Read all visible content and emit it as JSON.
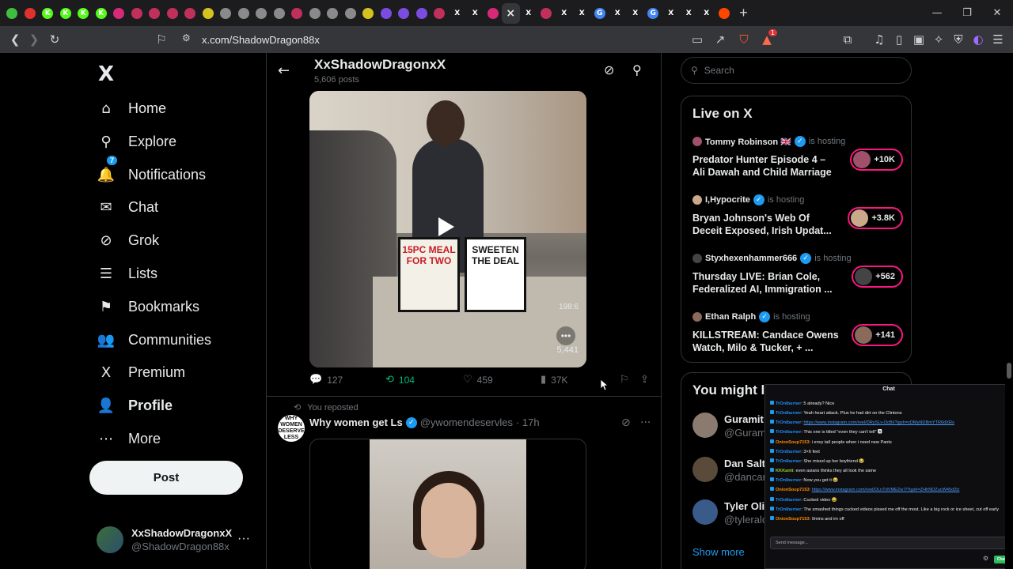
{
  "browser": {
    "url": "x.com/ShadowDragon88x",
    "tabs": [
      {
        "icon": "green-circle-icon",
        "color": "#3fbf3f",
        "glyph": ""
      },
      {
        "icon": "red-circle-icon",
        "color": "#e03030",
        "glyph": ""
      },
      {
        "icon": "kick-icon",
        "color": "#53fc18",
        "glyph": "K"
      },
      {
        "icon": "kick-icon",
        "color": "#53fc18",
        "glyph": "K"
      },
      {
        "icon": "kick-icon",
        "color": "#53fc18",
        "glyph": "K"
      },
      {
        "icon": "kick-icon",
        "color": "#53fc18",
        "glyph": "K"
      },
      {
        "icon": "instagram-icon",
        "color": "#d62976",
        "glyph": ""
      },
      {
        "icon": "red-icon",
        "color": "#c0305a",
        "glyph": ""
      },
      {
        "icon": "red-icon",
        "color": "#c0305a",
        "glyph": ""
      },
      {
        "icon": "red-icon",
        "color": "#c0305a",
        "glyph": ""
      },
      {
        "icon": "red-icon",
        "color": "#c0305a",
        "glyph": ""
      },
      {
        "icon": "yellow-icon",
        "color": "#d4c21f",
        "glyph": ""
      },
      {
        "icon": "grey-icon",
        "color": "#8a8a8a",
        "glyph": ""
      },
      {
        "icon": "grey-icon",
        "color": "#8a8a8a",
        "glyph": ""
      },
      {
        "icon": "grey-icon",
        "color": "#8a8a8a",
        "glyph": ""
      },
      {
        "icon": "grey-icon",
        "color": "#8a8a8a",
        "glyph": ""
      },
      {
        "icon": "red-icon",
        "color": "#c0305a",
        "glyph": ""
      },
      {
        "icon": "grey-icon",
        "color": "#8a8a8a",
        "glyph": ""
      },
      {
        "icon": "grey-icon",
        "color": "#8a8a8a",
        "glyph": ""
      },
      {
        "icon": "grey-icon",
        "color": "#8a8a8a",
        "glyph": ""
      },
      {
        "icon": "yellow-icon",
        "color": "#d4c21f",
        "glyph": ""
      },
      {
        "icon": "purple-icon",
        "color": "#7a4de0",
        "glyph": ""
      },
      {
        "icon": "purple-icon",
        "color": "#7a4de0",
        "glyph": ""
      },
      {
        "icon": "purple-icon",
        "color": "#7a4de0",
        "glyph": ""
      },
      {
        "icon": "red-icon",
        "color": "#c0305a",
        "glyph": ""
      },
      {
        "icon": "x-icon",
        "color": "#000000",
        "glyph": "X"
      },
      {
        "icon": "x-icon",
        "color": "#000000",
        "glyph": "X"
      },
      {
        "icon": "instagram-icon",
        "color": "#d62976",
        "glyph": ""
      },
      {
        "icon": "close-icon",
        "color": "#35363a",
        "glyph": "×"
      },
      {
        "icon": "x-icon",
        "color": "#000000",
        "glyph": "X"
      },
      {
        "icon": "red-icon",
        "color": "#c0305a",
        "glyph": ""
      },
      {
        "icon": "x-icon",
        "color": "#000000",
        "glyph": "X"
      },
      {
        "icon": "x-icon",
        "color": "#000000",
        "glyph": "X"
      },
      {
        "icon": "google-icon",
        "color": "#4285f4",
        "glyph": "G"
      },
      {
        "icon": "x-icon",
        "color": "#000000",
        "glyph": "X"
      },
      {
        "icon": "x-icon",
        "color": "#000000",
        "glyph": "X"
      },
      {
        "icon": "google-icon",
        "color": "#4285f4",
        "glyph": "G"
      },
      {
        "icon": "x-icon",
        "color": "#000000",
        "glyph": "X"
      },
      {
        "icon": "x-icon",
        "color": "#000000",
        "glyph": "X"
      },
      {
        "icon": "x-icon",
        "color": "#000000",
        "glyph": "X"
      },
      {
        "icon": "reddit-icon",
        "color": "#ff4500",
        "glyph": ""
      }
    ],
    "brave_badge": "1"
  },
  "nav": {
    "logo": "X",
    "items": [
      {
        "label": "Home",
        "icon": "home-icon",
        "glyph": "⌂"
      },
      {
        "label": "Explore",
        "icon": "search-icon",
        "glyph": "⚲"
      },
      {
        "label": "Notifications",
        "icon": "bell-icon",
        "glyph": "🔔",
        "badge": "7"
      },
      {
        "label": "Chat",
        "icon": "mail-icon",
        "glyph": "✉"
      },
      {
        "label": "Grok",
        "icon": "grok-icon",
        "glyph": "⊘"
      },
      {
        "label": "Lists",
        "icon": "lists-icon",
        "glyph": "☰"
      },
      {
        "label": "Bookmarks",
        "icon": "bookmark-icon",
        "glyph": "⚑"
      },
      {
        "label": "Communities",
        "icon": "communities-icon",
        "glyph": "👥"
      },
      {
        "label": "Premium",
        "icon": "x-premium-icon",
        "glyph": "X"
      },
      {
        "label": "Profile",
        "icon": "profile-icon",
        "glyph": "👤"
      },
      {
        "label": "More",
        "icon": "more-icon",
        "glyph": "⋯"
      }
    ],
    "post_button": "Post",
    "account": {
      "name": "XxShadowDragonxX",
      "handle": "@ShadowDragon88x",
      "more": "···"
    }
  },
  "profile_header": {
    "title": "XxShadowDragonxX",
    "posts": "5,606 posts"
  },
  "tweet1": {
    "video": {
      "sign1": "15PC MEAL FOR TWO",
      "sign2": "SWEETEN THE DEAL",
      "time": "198:6",
      "views": "5,441"
    },
    "replies": "127",
    "reposts": "104",
    "likes": "459",
    "views": "37K"
  },
  "tweet2": {
    "repost_note": "You reposted",
    "avatar_text": "WHY WOMEN DESERVE LESS",
    "name": "Why women get Ls",
    "handle": "@ywomendeservles",
    "time": "· 17h"
  },
  "sidebar": {
    "search_placeholder": "Search",
    "live_title": "Live on X",
    "live": [
      {
        "host": "Tommy Robinson 🇬🇧",
        "status": "is hosting",
        "title": "Predator Hunter Episode 4 – Ali Dawah and Child Marriage",
        "count": "+10K",
        "color": "#a0506a"
      },
      {
        "host": "I,Hypocrite",
        "status": "is hosting",
        "title": "Bryan Johnson's Web Of Deceit Exposed, Irish Updat...",
        "count": "+3.8K",
        "color": "#c9a98a"
      },
      {
        "host": "Styxhexenhammer666",
        "status": "is hosting",
        "title": "Thursday LIVE: Brian Cole, Federalized AI, Immigration ...",
        "count": "+562",
        "color": "#444444"
      },
      {
        "host": "Ethan Ralph",
        "status": "is hosting",
        "title": "KILLSTREAM: Candace Owens Watch, Milo & Tucker, + ...",
        "count": "+141",
        "color": "#8a6a5a"
      }
    ],
    "might_like_title": "You might l",
    "suggestions": [
      {
        "name": "Guramit",
        "handle": "@Gurami",
        "color": "#8a7a70"
      },
      {
        "name": "Dan Salt",
        "handle": "@dancar",
        "color": "#5a4a3a"
      },
      {
        "name": "Tyler Oli",
        "handle": "@tyleralc",
        "color": "#3a5a8a"
      }
    ],
    "show_more": "Show more"
  },
  "chat": {
    "title": "Chat",
    "lines": [
      {
        "user": "TrOnlburner",
        "cls": "",
        "text": ": 5 already? Nice"
      },
      {
        "user": "TrOnlburner",
        "cls": "",
        "text": ": Yeah heart attack. Plus he had dirt on the Clintons"
      },
      {
        "user": "TrOnlburner",
        "cls": "",
        "text": ": ",
        "link": "https://www.instagram.com/reel/DRySLv-DcBi/?igsh=cDMyNDBmYTR0dXRs"
      },
      {
        "user": "TrOnlburner",
        "cls": "",
        "text": ": This one is titled \"even they can't tell\" 🅰"
      },
      {
        "user": "OnionSoup7153",
        "cls": "o",
        "text": ": i envy tall people when i need new Pants"
      },
      {
        "user": "TrOnlburner",
        "cls": "",
        "text": ": 3×6 feet"
      },
      {
        "user": "TrOnlburner",
        "cls": "",
        "text": ": She mixed up her boyfriend 😂"
      },
      {
        "user": "KKKantt",
        "cls": "g",
        "text": ": even asians thinks they all look the same"
      },
      {
        "user": "TrOnlburner",
        "cls": "",
        "text": ": Now you get it 😂"
      },
      {
        "user": "OnionSoup7153",
        "cls": "o",
        "text": ": ",
        "link": "https://www.instagram.com/reel/DLnTdVMEZw7/?igsh=ZHhNDZucW45d2lz"
      },
      {
        "user": "TrOnlburner",
        "cls": "",
        "text": ": Cucked video 😂"
      },
      {
        "user": "TrOnlburner",
        "cls": "",
        "text": ": The smashed things cucked videos pissed me off the most. Like a big rock or ice sheet, cut off early"
      },
      {
        "user": "OnionSoup7153",
        "cls": "o",
        "text": ": 9mins and im off"
      }
    ],
    "input_placeholder": "Send message...",
    "send": "Chat"
  }
}
